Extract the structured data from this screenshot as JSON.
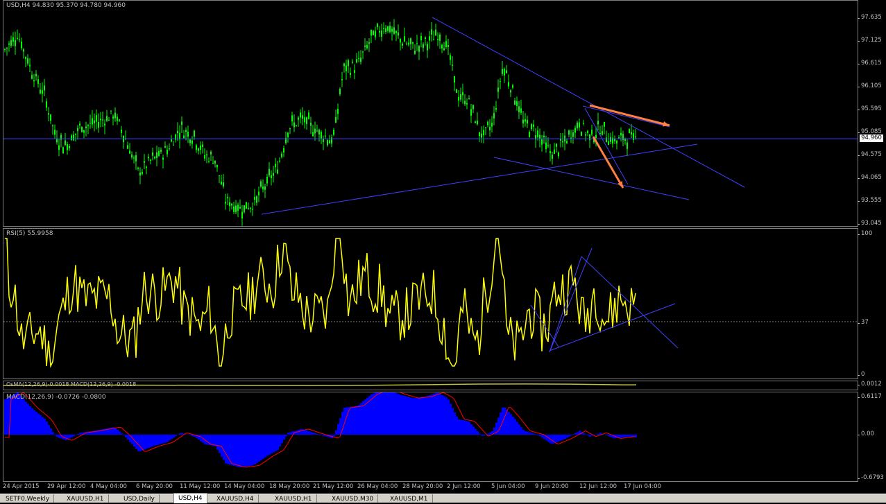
{
  "main": {
    "title": "USD,H4  94.830 95.370 94.780 94.960",
    "current_price": "94.960",
    "axis_ticks": [
      "97.635",
      "97.125",
      "96.615",
      "96.105",
      "95.595",
      "95.085",
      "94.575",
      "94.065",
      "93.555",
      "93.045"
    ]
  },
  "rsi": {
    "title": "RSI(5) 55.9958",
    "axis_ticks": [
      "100",
      "37",
      "0"
    ]
  },
  "osma": {
    "title": "OsMA(12,26,9)-0.0018  MACD(12,26,9) -0.0018",
    "axis_value": "0.0012"
  },
  "macd": {
    "title": "MACD(12,26,9) -0.0726 -0.0800",
    "axis_ticks": [
      "0.6117",
      "0.00",
      "-0.6793"
    ]
  },
  "time_axis": [
    "24 Apr 2015",
    "29 Apr 12:00",
    "4 May 04:00",
    "6 May 20:00",
    "11 May 12:00",
    "14 May 04:00",
    "18 May 20:00",
    "21 May 12:00",
    "26 May 04:00",
    "28 May 20:00",
    "2 Jun 12:00",
    "5 Jun 04:00",
    "9 Jun 20:00",
    "12 Jun 12:00",
    "17 Jun 04:00"
  ],
  "tabs": [
    "SETF0,Weekly",
    "XAUUSD,H1",
    "USD,Daily",
    "USD,H4",
    "XAUUSD,H4",
    "XAUUSD,H1",
    "XAUUSD,M30",
    "XAUUSD,M1"
  ],
  "colors": {
    "candle": "#00ff00",
    "rsi": "#ffff00",
    "macd_hist": "#0000ff",
    "macd_signal": "#ff0000",
    "trendline": "#4040ff",
    "arrow": "#ff8040",
    "osma": "#c0c040"
  }
}
